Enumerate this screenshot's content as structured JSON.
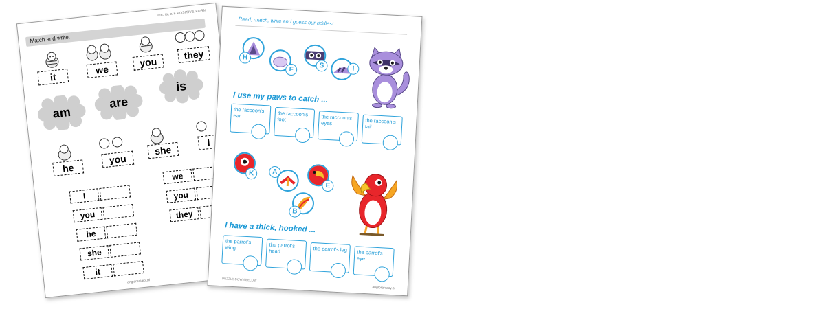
{
  "left_sheet": {
    "header": "am, is, are POSITIVE FORM",
    "instruction": "Match and write.",
    "pronouns_row1": [
      "it",
      "we",
      "you",
      "they"
    ],
    "verbs": [
      "am",
      "are",
      "is"
    ],
    "pronouns_row2": [
      "he",
      "you",
      "she",
      "I"
    ],
    "write_col1": [
      "I",
      "you",
      "he",
      "she",
      "it"
    ],
    "write_col2": [
      "we",
      "you",
      "they"
    ],
    "footer": "angloraniacy.pl"
  },
  "right_sheet": {
    "instruction": "Read, match, write and guess our riddles!",
    "raccoon_letters": [
      "H",
      "F",
      "S",
      "I"
    ],
    "riddle1": "I use my paws to catch ...",
    "raccoon_cards": [
      "the raccoon's ear",
      "the raccoon's foot",
      "the raccoon's eyes",
      "the raccoon's tail"
    ],
    "parrot_letters": [
      "K",
      "A",
      "E",
      "B"
    ],
    "riddle2": "I have a thick, hooked ...",
    "parrot_cards": [
      "the parrot's wing",
      "the parrot's head",
      "the parrot's leg",
      "the parrot's eye"
    ],
    "footer_left": "PUZZLE DOWN BELOW",
    "footer_right": "angloraniacy.pl"
  },
  "colors": {
    "accent_blue": "#2fa3db",
    "raccoon_purple": "#a98fdc",
    "parrot_red": "#e8262b"
  }
}
